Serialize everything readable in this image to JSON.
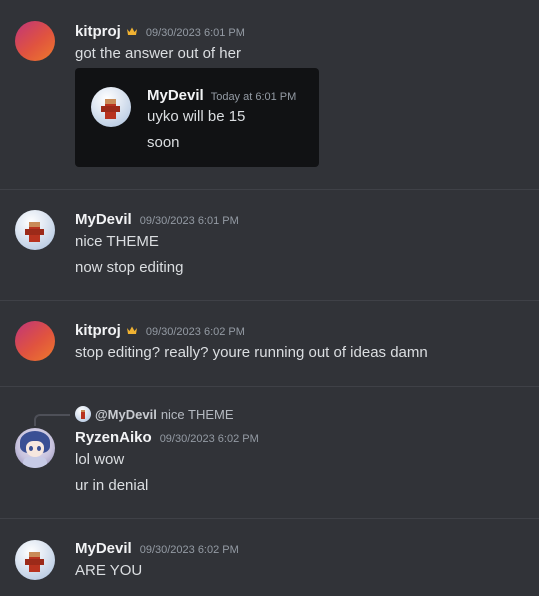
{
  "messages": [
    {
      "author": "kitproj",
      "owner_icon": "crown-icon",
      "timestamp": "09/30/2023 6:01 PM",
      "lines": [
        "got the answer out of her"
      ],
      "embed": {
        "author": "MyDevil",
        "timestamp": "Today at 6:01 PM",
        "lines": [
          "uyko will be 15",
          "soon"
        ]
      }
    },
    {
      "author": "MyDevil",
      "timestamp": "09/30/2023 6:01 PM",
      "lines": [
        "nice THEME",
        "now stop editing"
      ]
    },
    {
      "author": "kitproj",
      "owner_icon": "crown-icon",
      "timestamp": "09/30/2023 6:02 PM",
      "lines": [
        "stop editing? really? youre running out of ideas damn"
      ]
    },
    {
      "author": "RyzenAiko",
      "timestamp": "09/30/2023 6:02 PM",
      "reply": {
        "mention": "@MyDevil",
        "text": "nice THEME"
      },
      "lines": [
        "lol wow",
        "ur in denial"
      ]
    },
    {
      "author": "MyDevil",
      "timestamp": "09/30/2023 6:02 PM",
      "lines": [
        "ARE YOU"
      ]
    }
  ],
  "colors": {
    "background": "#313338",
    "embed_background": "#111214",
    "crown": "#f0b232",
    "username": "#f2f3f5",
    "timestamp": "#949ba4",
    "message_text": "#dbdee1"
  }
}
